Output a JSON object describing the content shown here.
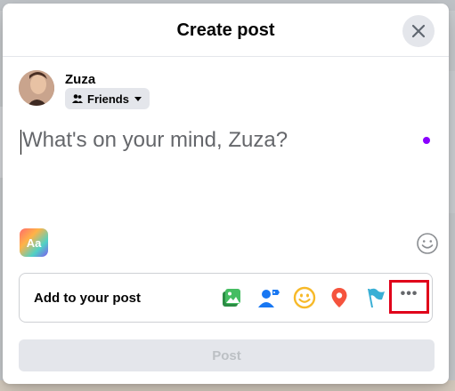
{
  "dialog": {
    "title": "Create post",
    "close_icon": "close-icon"
  },
  "user": {
    "name": "Zuza",
    "audience_label": "Friends",
    "audience_icon": "friends-icon",
    "audience_caret_icon": "caret-down-icon"
  },
  "composer": {
    "placeholder": "What's on your mind, Zuza?",
    "text_format_label": "Aa"
  },
  "add_to_post": {
    "label": "Add to your post",
    "icons": [
      "photo-video-icon",
      "tag-people-icon",
      "feeling-icon",
      "check-in-icon",
      "life-event-flag-icon",
      "more-icon"
    ],
    "more_label": "•••"
  },
  "post_button": {
    "label": "Post"
  },
  "colors": {
    "accent_purple": "#8a00ff",
    "highlight_red": "#e0001a",
    "photo_green": "#45bd62",
    "tag_blue": "#1877f2",
    "feeling_yellow": "#f7b928",
    "checkin_red": "#f5533d",
    "flag_teal": "#39afd5"
  }
}
